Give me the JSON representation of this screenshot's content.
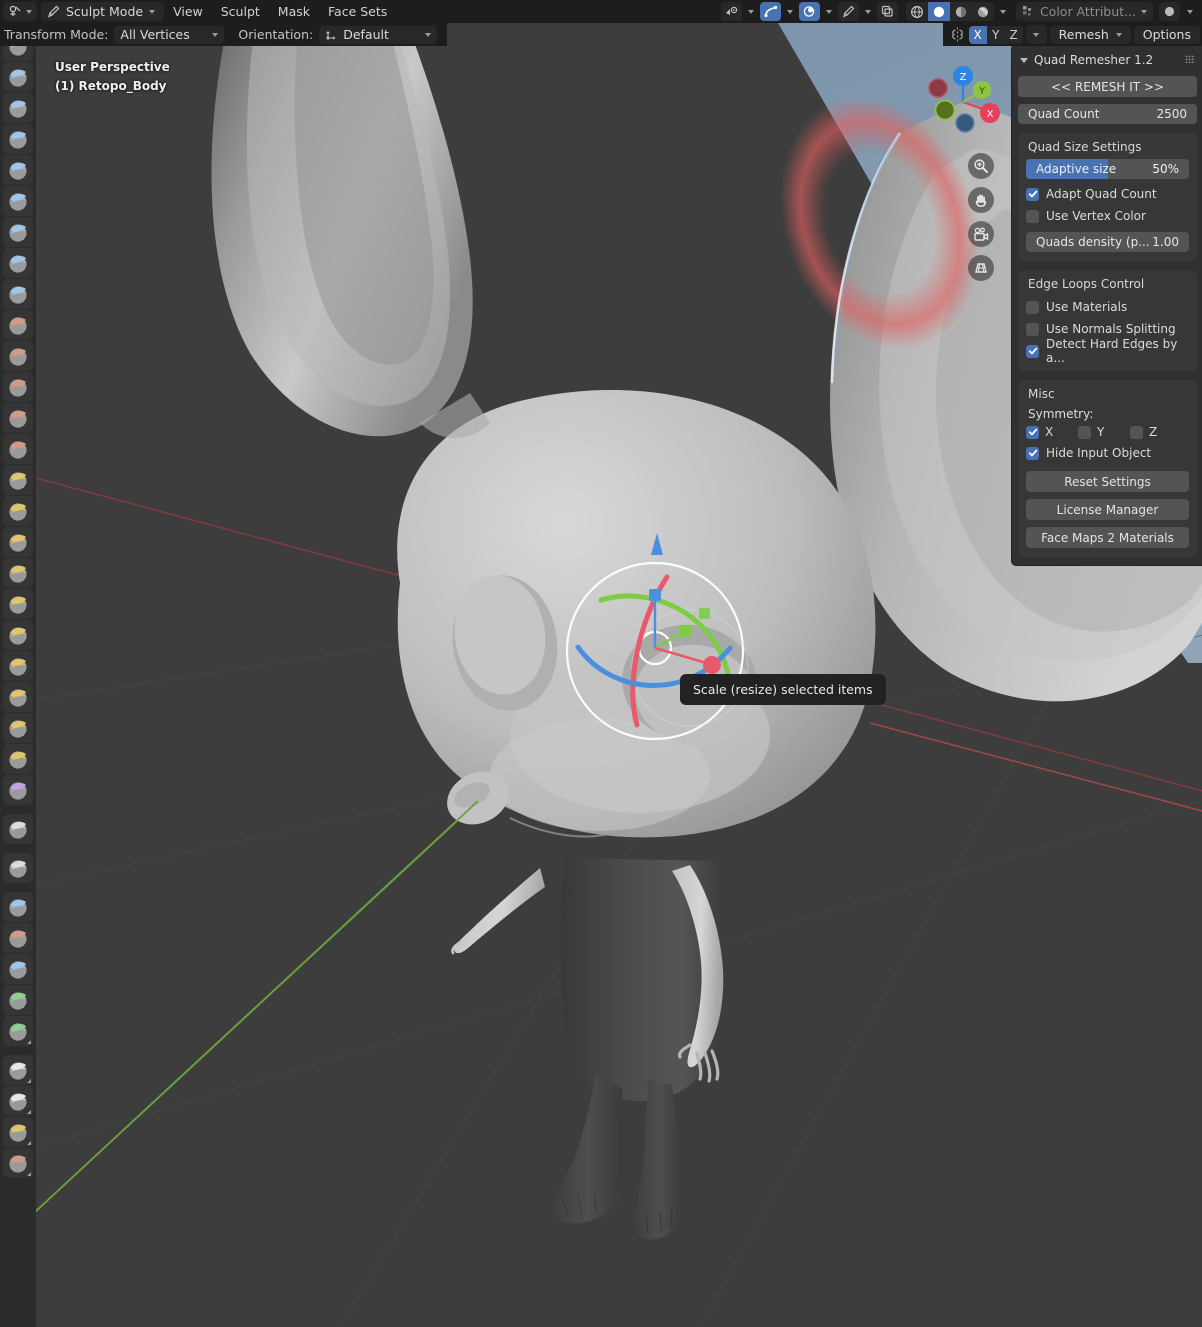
{
  "app": {
    "name": "Blender",
    "mode": "Sculpt Mode"
  },
  "topbar": {
    "editor_icon": "sculpt-editor-icon",
    "mode_icon": "brush-icon",
    "mode_label": "Sculpt Mode",
    "menus": [
      {
        "label": "View",
        "name": "menu-view"
      },
      {
        "label": "Sculpt",
        "name": "menu-sculpt"
      },
      {
        "label": "Mask",
        "name": "menu-mask"
      },
      {
        "label": "Face Sets",
        "name": "menu-face-sets"
      }
    ],
    "attribute_label": "Color Attribut...",
    "attribute_icon": "color-attribute-icon",
    "right_toggles": [
      {
        "name": "visibility-icon",
        "active": false
      },
      {
        "name": "snap-magnet-icon",
        "active": true
      },
      {
        "name": "proportional-editing-icon",
        "active": true
      },
      {
        "name": "brush-falloff-icon",
        "active": false
      },
      {
        "name": "overlays-icon",
        "active": false
      }
    ],
    "shading_modes": [
      {
        "name": "wireframe-shading-icon",
        "active": false
      },
      {
        "name": "solid-shading-icon",
        "active": true
      },
      {
        "name": "material-preview-shading-icon",
        "active": false
      },
      {
        "name": "rendered-shading-icon",
        "active": false
      }
    ]
  },
  "viewport_header": {
    "transform_mode_label": "Transform Mode:",
    "transform_mode_value": "All Vertices",
    "orientation_label": "Orientation:",
    "orientation_value": "Default",
    "orientation_icon": "orientation-axis-icon",
    "symmetry_icon": "symmetry-icon",
    "axes": [
      {
        "label": "X",
        "active": true
      },
      {
        "label": "Y",
        "active": false
      },
      {
        "label": "Z",
        "active": false
      }
    ],
    "remesh_label": "Remesh",
    "options_label": "Options"
  },
  "viewport": {
    "perspective_label": "User Perspective",
    "object_label": "(1) Retopo_Body",
    "tooltip": "Scale (resize) selected items",
    "background_color": "#3d3d3d",
    "sky_color": "#7f97ad",
    "axis_x_color": "#7c3b3b",
    "axis_y_color": "#4d7c3b",
    "nav_gizmo": {
      "axes": [
        {
          "label": "Z",
          "color": "#2f83e3"
        },
        {
          "label": "Y",
          "color": "#8cc63f"
        },
        {
          "label": "X",
          "color": "#e8405a"
        }
      ]
    },
    "view_buttons": [
      {
        "name": "zoom-view-button",
        "icon": "magnifier-plus-icon"
      },
      {
        "name": "pan-view-button",
        "icon": "hand-icon"
      },
      {
        "name": "camera-view-button",
        "icon": "camera-icon"
      },
      {
        "name": "orthographic-toggle-button",
        "icon": "grid-perspective-icon"
      }
    ],
    "gizmo": {
      "type": "scale-gizmo",
      "x_color": "#e8405a",
      "y_color": "#77c93d",
      "z_color": "#3b7fe0",
      "ring_color": "#ffffff"
    }
  },
  "toolbar": {
    "tools": [
      {
        "name": "tool-draw",
        "icon": "brush-draw-icon",
        "color": "#9fc6e6"
      },
      {
        "name": "tool-draw-sharp",
        "icon": "brush-draw-sharp-icon",
        "color": "#9fc6e6"
      },
      {
        "name": "tool-clay",
        "icon": "brush-clay-icon",
        "color": "#9fc6e6"
      },
      {
        "name": "tool-clay-strips",
        "icon": "brush-clay-strips-icon",
        "color": "#9fc6e6"
      },
      {
        "name": "tool-clay-thumb",
        "icon": "brush-clay-thumb-icon",
        "color": "#9fc6e6"
      },
      {
        "name": "tool-layer",
        "icon": "brush-layer-icon",
        "color": "#9fc6e6"
      },
      {
        "name": "tool-inflate",
        "icon": "brush-inflate-icon",
        "color": "#9fc6e6"
      },
      {
        "name": "tool-blob",
        "icon": "brush-blob-icon",
        "color": "#9fc6e6"
      },
      {
        "name": "tool-crease",
        "icon": "brush-crease-icon",
        "color": "#9fc6e6"
      },
      {
        "name": "tool-smooth",
        "icon": "brush-smooth-icon",
        "color": "#d09a86"
      },
      {
        "name": "tool-flatten",
        "icon": "brush-flatten-icon",
        "color": "#d09a86"
      },
      {
        "name": "tool-fill",
        "icon": "brush-fill-icon",
        "color": "#d09a86"
      },
      {
        "name": "tool-scrape",
        "icon": "brush-scrape-icon",
        "color": "#d09a86"
      },
      {
        "name": "tool-multiplane-scrape",
        "icon": "brush-multiplane-scrape-icon",
        "color": "#d09a86"
      },
      {
        "name": "tool-pinch",
        "icon": "brush-pinch-icon",
        "color": "#e0c56a"
      },
      {
        "name": "tool-grab",
        "icon": "brush-grab-icon",
        "color": "#e0c56a"
      },
      {
        "name": "tool-elastic-deform",
        "icon": "brush-elastic-deform-icon",
        "color": "#e0c56a"
      },
      {
        "name": "tool-snake-hook",
        "icon": "brush-snake-hook-icon",
        "color": "#e0c56a"
      },
      {
        "name": "tool-thumb",
        "icon": "brush-thumb-icon",
        "color": "#e0c56a"
      },
      {
        "name": "tool-pose",
        "icon": "brush-pose-icon",
        "color": "#e0c56a"
      },
      {
        "name": "tool-nudge",
        "icon": "brush-nudge-icon",
        "color": "#e0c56a"
      },
      {
        "name": "tool-rotate",
        "icon": "brush-rotate-icon",
        "color": "#e0c56a"
      },
      {
        "name": "tool-slide-relax",
        "icon": "brush-slide-relax-icon",
        "color": "#e0c56a"
      },
      {
        "name": "tool-boundary",
        "icon": "brush-boundary-icon",
        "color": "#e0c56a"
      },
      {
        "name": "tool-cloth",
        "icon": "brush-cloth-icon",
        "color": "#c5a2e0"
      },
      {
        "name": "tool-simplify",
        "icon": "brush-simplify-icon",
        "color": "#dcdcdc"
      },
      {
        "name": "tool-mask",
        "icon": "brush-mask-icon",
        "color": "#dcdcdc"
      },
      {
        "name": "tool-draw-face-sets",
        "icon": "brush-draw-face-sets-icon",
        "color": "#9fc6e6"
      },
      {
        "name": "tool-multires-displacement-eraser",
        "icon": "brush-multires-eraser-icon",
        "color": "#d09a86"
      },
      {
        "name": "tool-multires-displacement-smear",
        "icon": "brush-multires-smear-icon",
        "color": "#9fc6e6"
      },
      {
        "name": "tool-paint",
        "icon": "brush-paint-icon",
        "color": "#8fd08f"
      },
      {
        "name": "tool-smear",
        "icon": "brush-smear-icon",
        "color": "#8fd08f"
      },
      {
        "name": "tool-mask-lasso",
        "icon": "mask-lasso-icon",
        "color": "#e8e8e8"
      },
      {
        "name": "tool-mask-box",
        "icon": "mask-box-icon",
        "color": "#e8e8e8"
      },
      {
        "name": "tool-face-set-box",
        "icon": "face-set-box-icon",
        "color": "#e0c56a"
      },
      {
        "name": "tool-trim-box",
        "icon": "trim-box-icon",
        "color": "#d09a86"
      }
    ]
  },
  "quad_remesher": {
    "title": "Quad Remesher 1.2",
    "remesh_button": "<< REMESH IT >>",
    "quad_count_label": "Quad Count",
    "quad_count_value": "2500",
    "quad_size_settings": {
      "title": "Quad Size Settings",
      "adaptive_size_label": "Adaptive size",
      "adaptive_size_value": "50%",
      "adaptive_size_fill_pct": 50,
      "adapt_quad_count_label": "Adapt Quad Count",
      "adapt_quad_count_checked": true,
      "use_vertex_color_label": "Use Vertex Color",
      "use_vertex_color_checked": false,
      "quads_density_label": "Quads density (p...",
      "quads_density_value": "1.00"
    },
    "edge_loops_control": {
      "title": "Edge Loops Control",
      "use_materials_label": "Use Materials",
      "use_materials_checked": false,
      "use_normals_splitting_label": "Use Normals Splitting",
      "use_normals_splitting_checked": false,
      "detect_hard_edges_label": "Detect Hard Edges by a...",
      "detect_hard_edges_checked": true
    },
    "misc": {
      "title": "Misc",
      "symmetry_label": "Symmetry:",
      "symmetry": [
        {
          "label": "X",
          "checked": true
        },
        {
          "label": "Y",
          "checked": false
        },
        {
          "label": "Z",
          "checked": false
        }
      ],
      "hide_input_object_label": "Hide Input Object",
      "hide_input_object_checked": true,
      "reset_settings_label": "Reset Settings",
      "license_manager_label": "License Manager",
      "face_maps_label": "Face Maps 2 Materials"
    },
    "accent_color": "#4772b3"
  }
}
